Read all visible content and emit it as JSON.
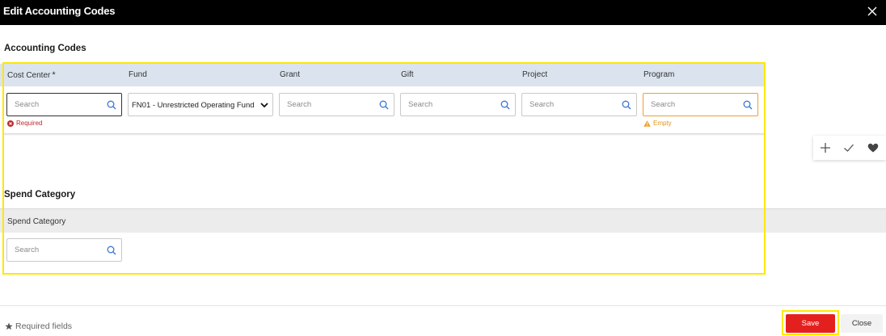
{
  "dialog": {
    "title": "Edit Accounting Codes"
  },
  "accounting": {
    "section_title": "Accounting Codes",
    "columns": {
      "cost_center": "Cost Center",
      "fund": "Fund",
      "grant": "Grant",
      "gift": "Gift",
      "project": "Project",
      "program": "Program"
    },
    "required_marker": "*",
    "fields": {
      "cost_center": {
        "placeholder": "Search",
        "message": "Required",
        "state": "error"
      },
      "fund": {
        "value": "FN01 - Unrestricted Operating Fund"
      },
      "grant": {
        "placeholder": "Search"
      },
      "gift": {
        "placeholder": "Search"
      },
      "project": {
        "placeholder": "Search"
      },
      "program": {
        "placeholder": "Search",
        "message": "Empty",
        "state": "warning"
      }
    }
  },
  "row_toolbar": {
    "icons": [
      "plus-icon",
      "check-icon",
      "heart-icon"
    ]
  },
  "spend": {
    "section_title": "Spend Category",
    "column": "Spend Category",
    "field": {
      "placeholder": "Search"
    }
  },
  "footer": {
    "required_note": "Required fields",
    "save_label": "Save",
    "close_label": "Close"
  },
  "colors": {
    "header_bar": "#000000",
    "grid_header": "#dbe4ee",
    "save_button": "#e4201f",
    "error": "#c0292b",
    "warning": "#e0951a",
    "highlight": "#fde800",
    "search_icon": "#3b78d8"
  }
}
